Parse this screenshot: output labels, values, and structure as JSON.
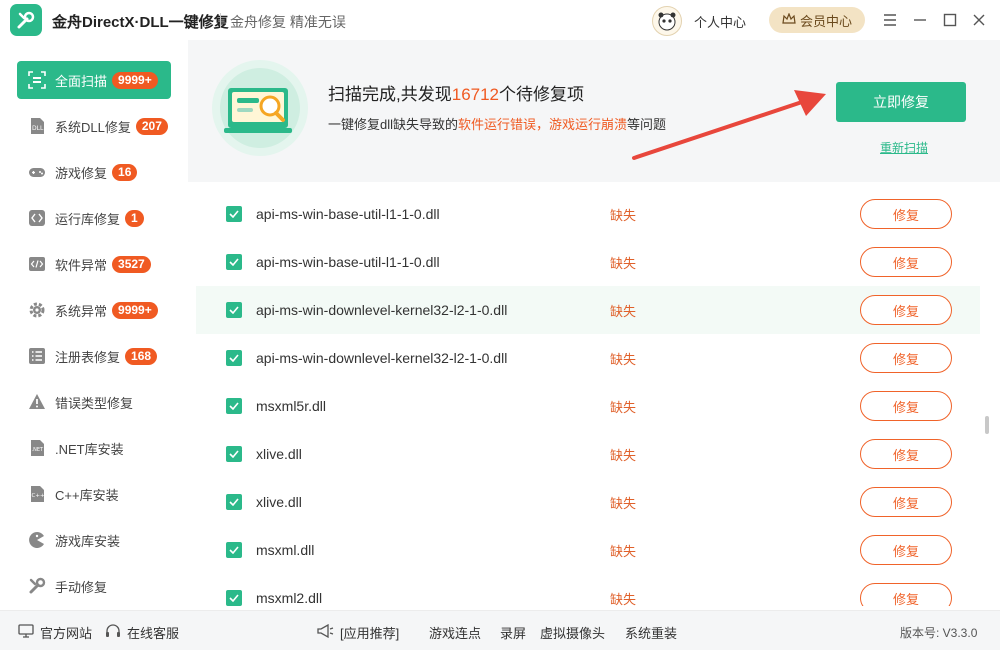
{
  "app": {
    "title": "金舟DirectX·DLL一键修复",
    "slogan": "金舟修复 精准无误",
    "user_center": "个人中心",
    "vip_center": "会员中心"
  },
  "sidebar": {
    "items": [
      {
        "label": "全面扫描",
        "badge": "9999+",
        "active": true
      },
      {
        "label": "系统DLL修复",
        "badge": "207"
      },
      {
        "label": "游戏修复",
        "badge": "16"
      },
      {
        "label": "运行库修复",
        "badge": "1"
      },
      {
        "label": "软件异常",
        "badge": "3527"
      },
      {
        "label": "系统异常",
        "badge": "9999+"
      },
      {
        "label": "注册表修复",
        "badge": "168"
      },
      {
        "label": "错误类型修复",
        "badge": null
      },
      {
        "label": ".NET库安装",
        "badge": null
      },
      {
        "label": "C++库安装",
        "badge": null
      },
      {
        "label": "游戏库安装",
        "badge": null
      },
      {
        "label": "手动修复",
        "badge": null
      }
    ]
  },
  "header": {
    "title_prefix": "扫描完成,共发现",
    "count": "16712",
    "title_suffix": "个待修复项",
    "sub_prefix": "一键修复dll缺失导致的",
    "sub_highlight": "软件运行错误，游戏运行崩溃",
    "sub_suffix": "等问题",
    "fix_now": "立即修复",
    "rescan": "重新扫描"
  },
  "list": {
    "rows": [
      {
        "name": "api-ms-win-base-util-l1-1-0.dll",
        "status": "缺失",
        "action": "修复"
      },
      {
        "name": "api-ms-win-base-util-l1-1-0.dll",
        "status": "缺失",
        "action": "修复"
      },
      {
        "name": "api-ms-win-downlevel-kernel32-l2-1-0.dll",
        "status": "缺失",
        "action": "修复"
      },
      {
        "name": "api-ms-win-downlevel-kernel32-l2-1-0.dll",
        "status": "缺失",
        "action": "修复"
      },
      {
        "name": "msxml5r.dll",
        "status": "缺失",
        "action": "修复"
      },
      {
        "name": "xlive.dll",
        "status": "缺失",
        "action": "修复"
      },
      {
        "name": "xlive.dll",
        "status": "缺失",
        "action": "修复"
      },
      {
        "name": "msxml.dll",
        "status": "缺失",
        "action": "修复"
      },
      {
        "name": "msxml2.dll",
        "status": "缺失",
        "action": "修复"
      }
    ]
  },
  "footer": {
    "website": "官方网站",
    "service": "在线客服",
    "app_recommend": "[应用推荐]",
    "links": [
      "游戏连点",
      "录屏",
      "虚拟摄像头",
      "系统重装"
    ],
    "version": "版本号: V3.3.0"
  },
  "colors": {
    "accent": "#2bb98a",
    "warning": "#f05a22"
  }
}
